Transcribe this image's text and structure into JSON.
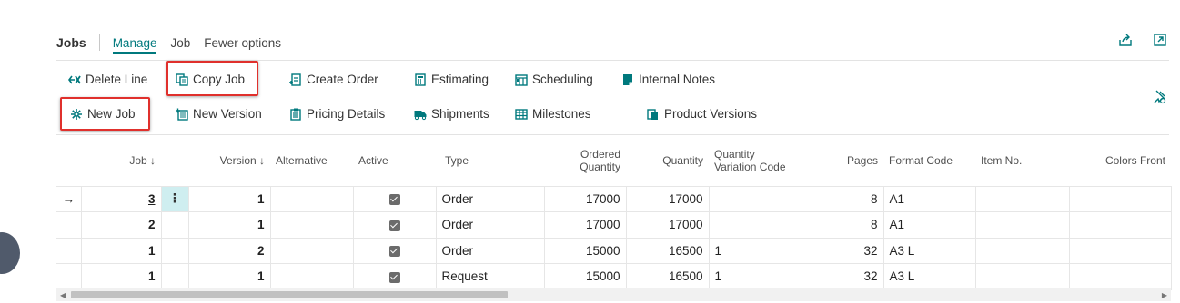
{
  "page": {
    "title": "Jobs",
    "tabs": [
      {
        "label": "Manage",
        "active": true
      },
      {
        "label": "Job",
        "active": false
      },
      {
        "label": "Fewer options",
        "active": false
      }
    ]
  },
  "actions": {
    "delete_line": "Delete Line",
    "copy_job": "Copy Job",
    "create_order": "Create Order",
    "estimating": "Estimating",
    "scheduling": "Scheduling",
    "internal_notes": "Internal Notes",
    "new_job": "New Job",
    "new_version": "New Version",
    "pricing_details": "Pricing Details",
    "shipments": "Shipments",
    "milestones": "Milestones",
    "product_versions": "Product Versions"
  },
  "grid": {
    "columns": {
      "job": "Job ↓",
      "version": "Version ↓",
      "alternative": "Alternative",
      "active": "Active",
      "type": "Type",
      "ordered_quantity_1": "Ordered",
      "ordered_quantity_2": "Quantity",
      "quantity": "Quantity",
      "qvc_1": "Quantity",
      "qvc_2": "Variation Code",
      "pages": "Pages",
      "format_code": "Format Code",
      "item_no": "Item No.",
      "colors_front": "Colors Front"
    },
    "rows": [
      {
        "job": "3",
        "version": "1",
        "alternative": "",
        "active": true,
        "type": "Order",
        "ordered_quantity": "17000",
        "quantity": "17000",
        "qvc": "",
        "pages": "8",
        "format_code": "A1",
        "item_no": "",
        "colors_front": ""
      },
      {
        "job": "2",
        "version": "1",
        "alternative": "",
        "active": true,
        "type": "Order",
        "ordered_quantity": "17000",
        "quantity": "17000",
        "qvc": "",
        "pages": "8",
        "format_code": "A1",
        "item_no": "",
        "colors_front": ""
      },
      {
        "job": "1",
        "version": "2",
        "alternative": "",
        "active": true,
        "type": "Order",
        "ordered_quantity": "15000",
        "quantity": "16500",
        "qvc": "1",
        "pages": "32",
        "format_code": "A3 L",
        "item_no": "",
        "colors_front": ""
      },
      {
        "job": "1",
        "version": "1",
        "alternative": "",
        "active": true,
        "type": "Request",
        "ordered_quantity": "15000",
        "quantity": "16500",
        "qvc": "1",
        "pages": "32",
        "format_code": "A3 L",
        "item_no": "",
        "colors_front": ""
      }
    ]
  },
  "colors": {
    "accent": "#00797d",
    "highlight": "#e0302c"
  }
}
